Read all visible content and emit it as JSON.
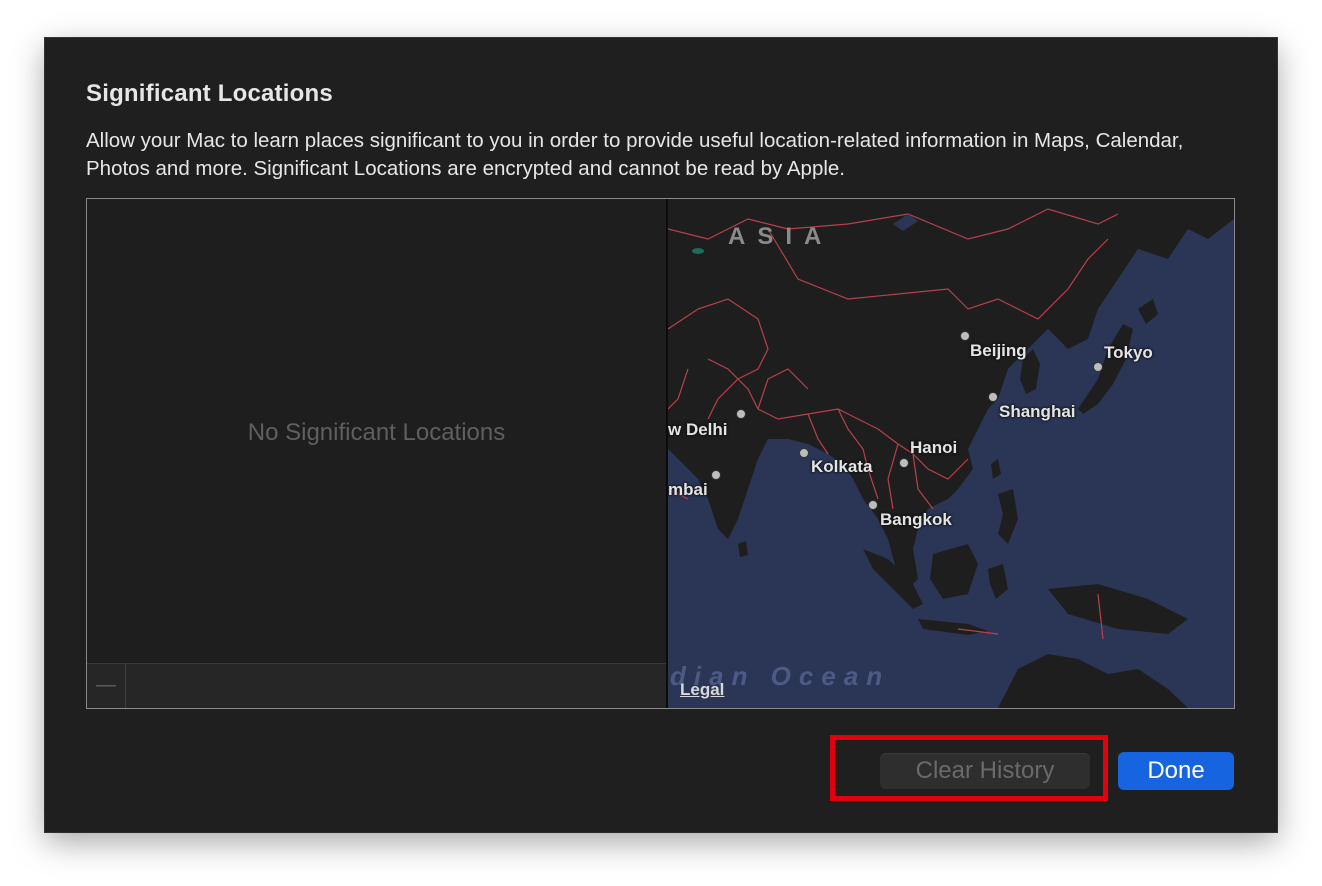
{
  "dialog": {
    "title": "Significant Locations",
    "description": "Allow your Mac to learn places significant to you in order to provide useful location-related information in Maps, Calendar, Photos and more. Significant Locations are encrypted and cannot be read by Apple."
  },
  "list": {
    "empty_message": "No Significant Locations",
    "remove_label": "—"
  },
  "map": {
    "region_label": "ASIA",
    "ocean_label": "dian Ocean",
    "legal_label": "Legal",
    "cities": [
      "Beijing",
      "Tokyo",
      "Shanghai",
      "w Delhi",
      "Hanoi",
      "Kolkata",
      "mbai",
      "Bangkok"
    ]
  },
  "buttons": {
    "clear_history": "Clear History",
    "done": "Done"
  },
  "colors": {
    "dialog_bg": "#1f1f1f",
    "map_ocean": "#2b3656",
    "map_land": "#1e1e1e",
    "border_lines": "#b8404a",
    "done_button": "#1664e0",
    "highlight_box": "#e0000f"
  }
}
